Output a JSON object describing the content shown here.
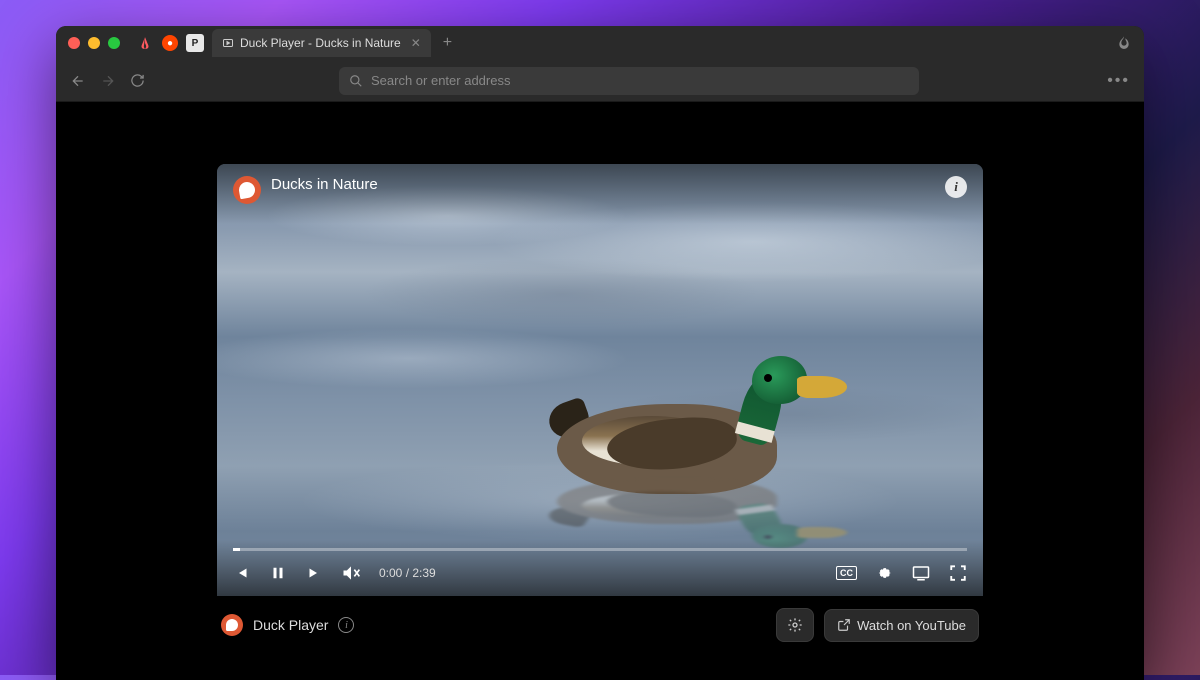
{
  "tab": {
    "title": "Duck Player - Ducks in Nature"
  },
  "toolbar": {
    "search_placeholder": "Search or enter address"
  },
  "video": {
    "title": "Ducks in Nature",
    "current_time": "0:00",
    "duration": "2:39",
    "time_separator": " / "
  },
  "footer": {
    "app_name": "Duck Player",
    "watch_label": "Watch on YouTube"
  },
  "cc_label": "CC"
}
